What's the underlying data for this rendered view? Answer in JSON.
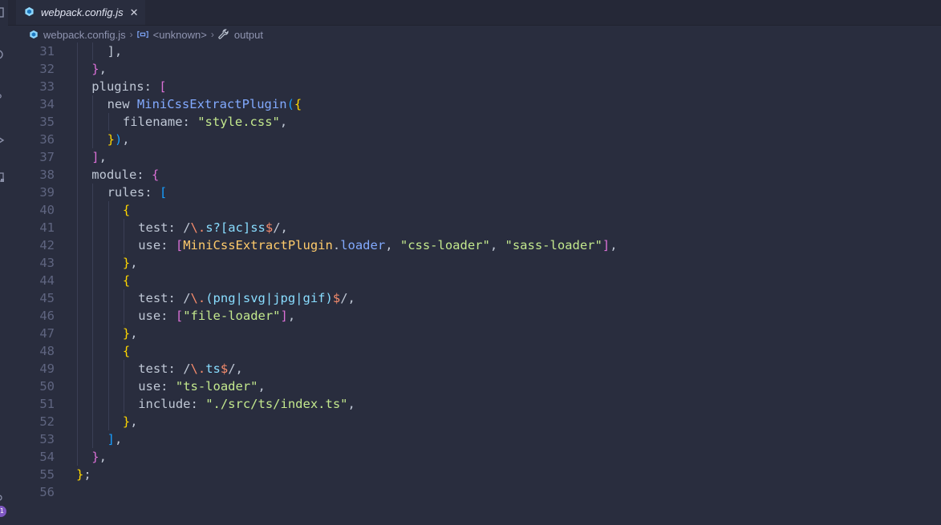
{
  "tab": {
    "title": "webpack.config.js",
    "close_label": "✕"
  },
  "breadcrumb": {
    "file": "webpack.config.js",
    "scope": "<unknown>",
    "symbol": "output"
  },
  "activity_bar": {
    "badge_count": "1"
  },
  "editor": {
    "lines": [
      {
        "n": "31",
        "indent": 2,
        "tokens": [
          [
            "p",
            "],"
          ]
        ]
      },
      {
        "n": "32",
        "indent": 1,
        "tokens": [
          [
            "b2",
            "}"
          ],
          [
            "p",
            ","
          ]
        ]
      },
      {
        "n": "33",
        "indent": 1,
        "tokens": [
          [
            "p",
            "plugins: "
          ],
          [
            "b2",
            "["
          ]
        ]
      },
      {
        "n": "34",
        "indent": 2,
        "tokens": [
          [
            "p",
            "new "
          ],
          [
            "fn",
            "MiniCssExtractPlugin"
          ],
          [
            "b3",
            "("
          ],
          [
            "b1",
            "{"
          ]
        ]
      },
      {
        "n": "35",
        "indent": 3,
        "tokens": [
          [
            "p",
            "filename: "
          ],
          [
            "str",
            "\"style.css\""
          ],
          [
            "p",
            ","
          ]
        ]
      },
      {
        "n": "36",
        "indent": 2,
        "tokens": [
          [
            "b1",
            "}"
          ],
          [
            "b3",
            ")"
          ],
          [
            "p",
            ","
          ]
        ]
      },
      {
        "n": "37",
        "indent": 1,
        "tokens": [
          [
            "b2",
            "]"
          ],
          [
            "p",
            ","
          ]
        ]
      },
      {
        "n": "38",
        "indent": 1,
        "tokens": [
          [
            "p",
            "module: "
          ],
          [
            "b2",
            "{"
          ]
        ]
      },
      {
        "n": "39",
        "indent": 2,
        "tokens": [
          [
            "p",
            "rules: "
          ],
          [
            "b3",
            "["
          ]
        ]
      },
      {
        "n": "40",
        "indent": 3,
        "tokens": [
          [
            "b1",
            "{"
          ]
        ]
      },
      {
        "n": "41",
        "indent": 4,
        "tokens": [
          [
            "p",
            "test: "
          ],
          [
            "p",
            "/"
          ],
          [
            "rxc",
            "\\."
          ],
          [
            "rx",
            "s?"
          ],
          [
            "rx",
            "[ac]"
          ],
          [
            "rx",
            "ss"
          ],
          [
            "rxc",
            "$"
          ],
          [
            "p",
            "/,"
          ]
        ]
      },
      {
        "n": "42",
        "indent": 4,
        "tokens": [
          [
            "p",
            "use: "
          ],
          [
            "b2",
            "["
          ],
          [
            "cls",
            "MiniCssExtractPlugin"
          ],
          [
            "p",
            "."
          ],
          [
            "fn",
            "loader"
          ],
          [
            "p",
            ", "
          ],
          [
            "str",
            "\"css-loader\""
          ],
          [
            "p",
            ", "
          ],
          [
            "str",
            "\"sass-loader\""
          ],
          [
            "b2",
            "]"
          ],
          [
            "p",
            ","
          ]
        ]
      },
      {
        "n": "43",
        "indent": 3,
        "tokens": [
          [
            "b1",
            "}"
          ],
          [
            "p",
            ","
          ]
        ]
      },
      {
        "n": "44",
        "indent": 3,
        "tokens": [
          [
            "b1",
            "{"
          ]
        ]
      },
      {
        "n": "45",
        "indent": 4,
        "tokens": [
          [
            "p",
            "test: "
          ],
          [
            "p",
            "/"
          ],
          [
            "rxc",
            "\\."
          ],
          [
            "rx",
            "(png|svg|jpg|gif)"
          ],
          [
            "rxc",
            "$"
          ],
          [
            "p",
            "/,"
          ]
        ]
      },
      {
        "n": "46",
        "indent": 4,
        "tokens": [
          [
            "p",
            "use: "
          ],
          [
            "b2",
            "["
          ],
          [
            "str",
            "\"file-loader\""
          ],
          [
            "b2",
            "]"
          ],
          [
            "p",
            ","
          ]
        ]
      },
      {
        "n": "47",
        "indent": 3,
        "tokens": [
          [
            "b1",
            "}"
          ],
          [
            "p",
            ","
          ]
        ]
      },
      {
        "n": "48",
        "indent": 3,
        "tokens": [
          [
            "b1",
            "{"
          ]
        ]
      },
      {
        "n": "49",
        "indent": 4,
        "tokens": [
          [
            "p",
            "test: "
          ],
          [
            "p",
            "/"
          ],
          [
            "rxc",
            "\\."
          ],
          [
            "rx",
            "ts"
          ],
          [
            "rxc",
            "$"
          ],
          [
            "p",
            "/,"
          ]
        ]
      },
      {
        "n": "50",
        "indent": 4,
        "tokens": [
          [
            "p",
            "use: "
          ],
          [
            "str",
            "\"ts-loader\""
          ],
          [
            "p",
            ","
          ]
        ]
      },
      {
        "n": "51",
        "indent": 4,
        "tokens": [
          [
            "p",
            "include: "
          ],
          [
            "str",
            "\"./src/ts/index.ts\""
          ],
          [
            "p",
            ","
          ]
        ]
      },
      {
        "n": "52",
        "indent": 3,
        "tokens": [
          [
            "b1",
            "}"
          ],
          [
            "p",
            ","
          ]
        ]
      },
      {
        "n": "53",
        "indent": 2,
        "tokens": [
          [
            "b3",
            "]"
          ],
          [
            "p",
            ","
          ]
        ]
      },
      {
        "n": "54",
        "indent": 1,
        "tokens": [
          [
            "b2",
            "}"
          ],
          [
            "p",
            ","
          ]
        ]
      },
      {
        "n": "55",
        "indent": 0,
        "tokens": [
          [
            "b1",
            "}"
          ],
          [
            "p",
            ";"
          ]
        ]
      },
      {
        "n": "56",
        "indent": 0,
        "tokens": []
      }
    ]
  },
  "colors": {
    "background": "#292d3e",
    "tab_bar": "#252837",
    "line_number": "#5f6580",
    "string": "#c3e88d",
    "keyword": "#c792ea",
    "function": "#82aaff",
    "badge": "#7e57c2"
  }
}
